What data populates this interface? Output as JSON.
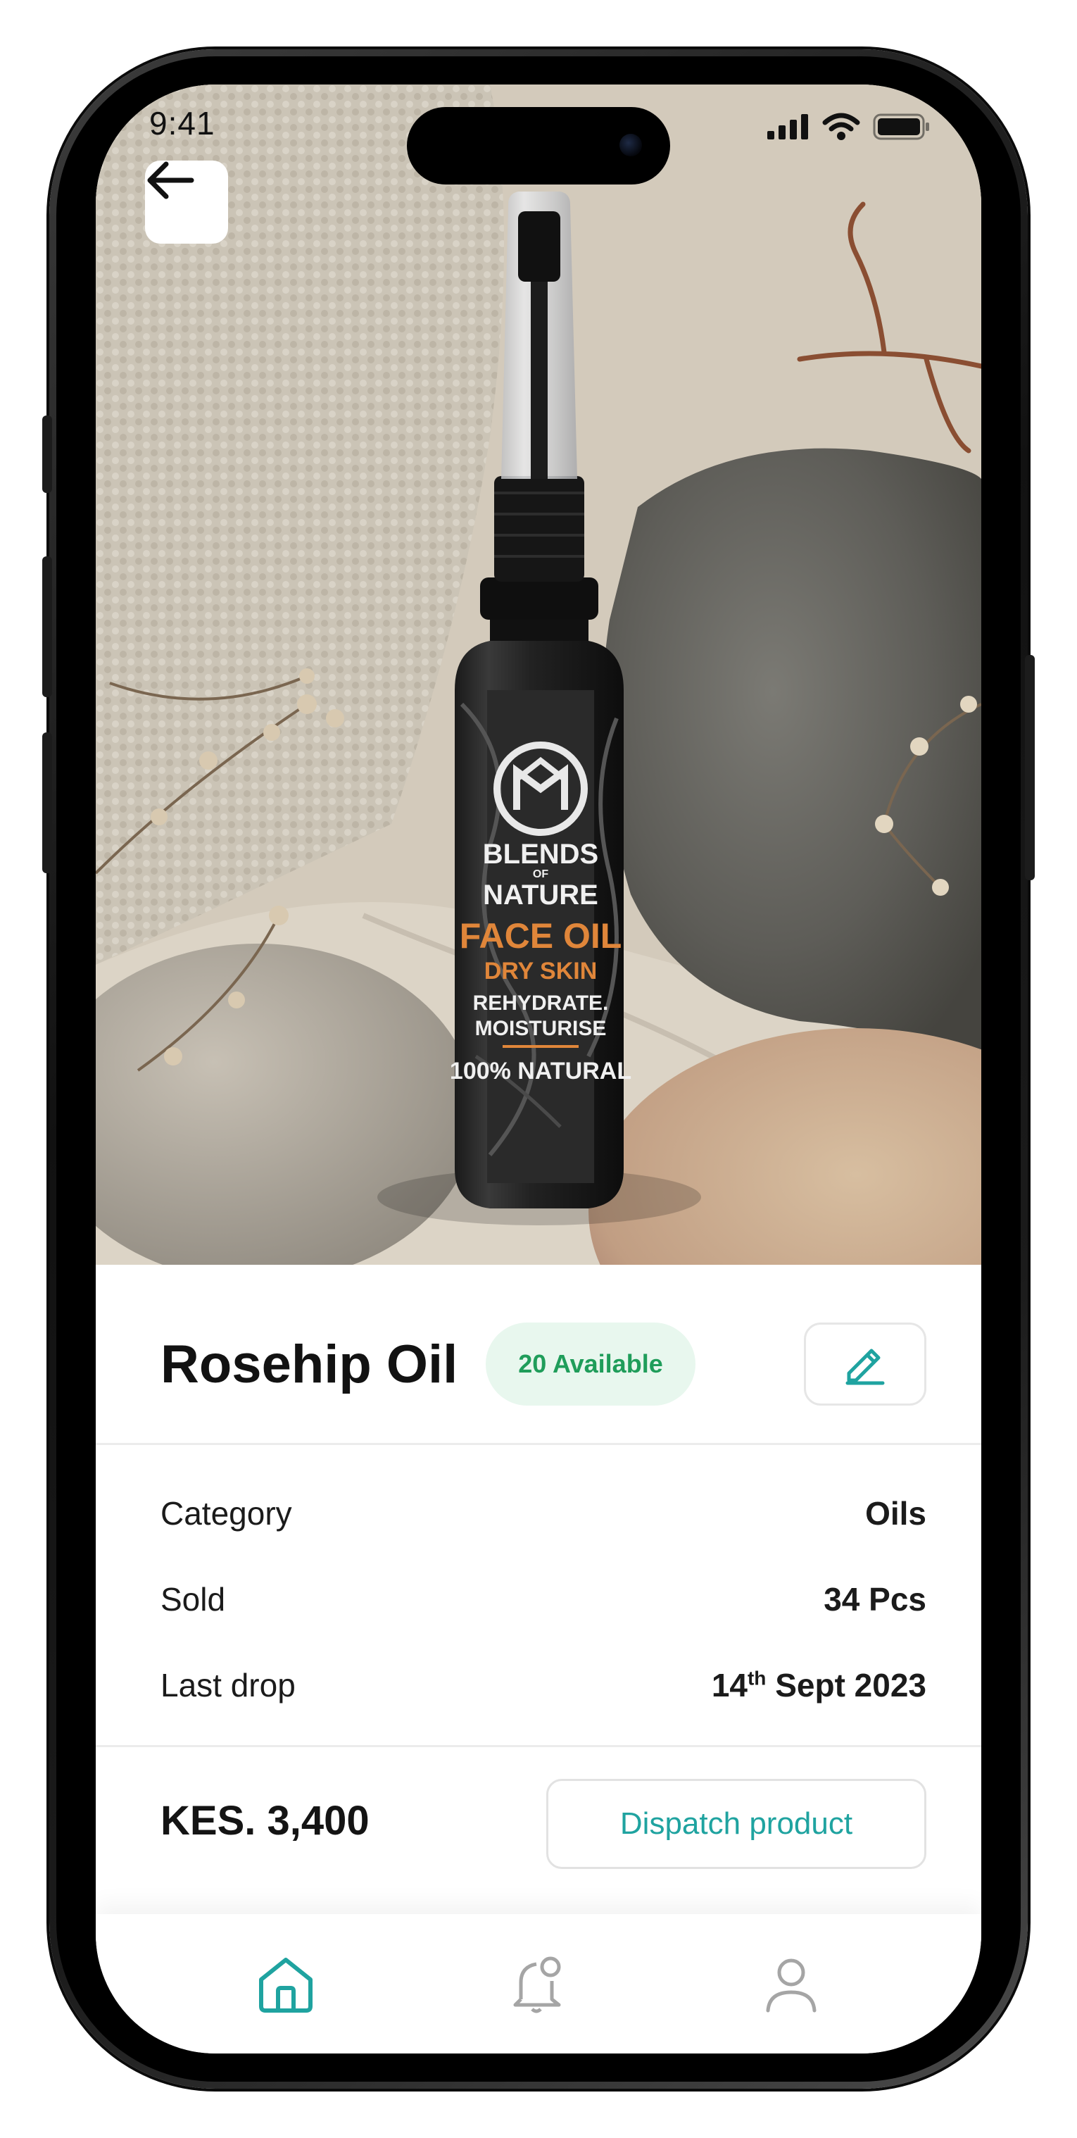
{
  "status_bar": {
    "time": "9:41"
  },
  "product": {
    "name": "Rosehip Oil",
    "availability": "20 Available",
    "label_lines": {
      "brand_top": "BLENDS",
      "brand_of": "OF",
      "brand_bottom": "NATURE",
      "product_line": "FACE OIL",
      "skin_type": "DRY SKIN",
      "benefit_1": "REHYDRATE.",
      "benefit_2": "MOISTURISE",
      "claim": "100% NATURAL"
    }
  },
  "details": [
    {
      "label": "Category",
      "value": "Oils"
    },
    {
      "label": "Sold",
      "value": "34 Pcs"
    },
    {
      "label": "Last drop",
      "value_day": "14",
      "value_suffix": "th",
      "value_rest": " Sept 2023"
    }
  ],
  "price": "KES. 3,400",
  "actions": {
    "dispatch": "Dispatch product"
  },
  "bottom_nav": [
    "home-icon",
    "notification-bell-icon",
    "profile-icon"
  ],
  "colors": {
    "accent": "#1fa3a0",
    "available_text": "#1f9d5a",
    "available_bg": "#e8f7ee",
    "label_orange": "#e0863a"
  }
}
